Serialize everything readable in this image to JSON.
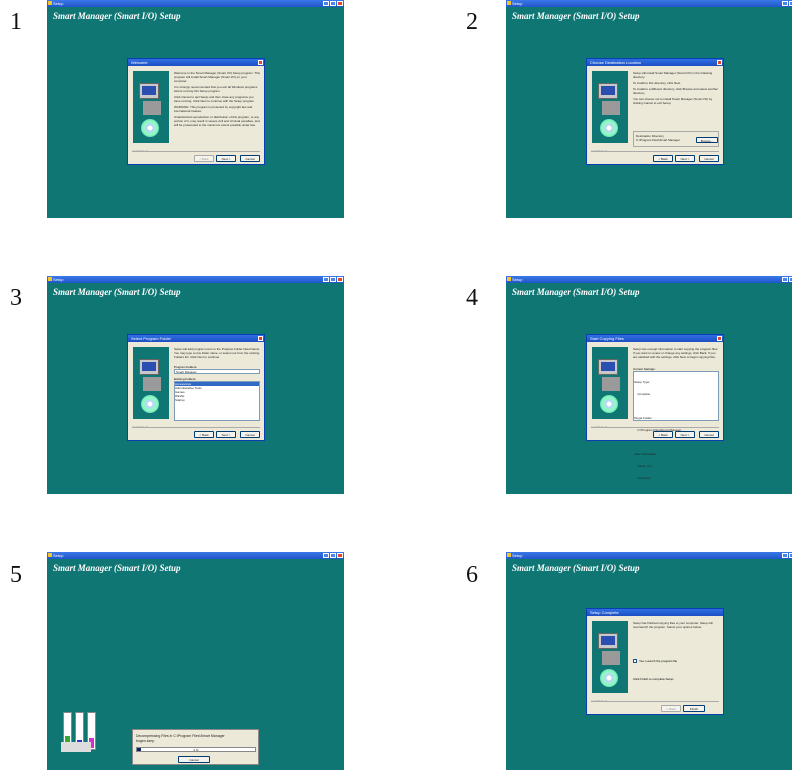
{
  "steps": [
    {
      "number": "1",
      "window_title": "Setup",
      "app_title": "Smart Manager (Smart I/O) Setup",
      "dialog": {
        "title": "Welcome",
        "paragraphs": [
          "Welcome to the Smart Manager (Smart I/O) Setup program. This program will install Smart Manager (Smart I/O) on your computer.",
          "It is strongly recommended that you exit all Windows programs before running this Setup program.",
          "Click Cancel to quit Setup and then close any programs you have running. Click Next to continue with the Setup program.",
          "WARNING: This program is protected by copyright law and international treaties.",
          "Unauthorized reproduction or distribution of this program, or any portion of it, may result in severe civil and criminal penalties, and will be prosecuted to the maximum extent possible under law."
        ],
        "brand": "InstallShield",
        "back": "< Back",
        "next": "Next >",
        "cancel": "Cancel"
      }
    },
    {
      "number": "2",
      "window_title": "Setup",
      "app_title": "Smart Manager (Smart I/O) Setup",
      "dialog": {
        "title": "Choose Destination Location",
        "paragraphs": [
          "Setup will install Smart Manager (Smart I/O) in the following directory.",
          "To install to this directory, click Next.",
          "To install to a different directory, click Browse and select another directory.",
          "You can choose not to install Smart Manager (Smart I/O) by clicking Cancel to exit Setup."
        ],
        "group_label": "Destination Directory",
        "path": "C:\\Program Files\\Smart Manager",
        "browse": "Browse...",
        "brand": "InstallShield",
        "back": "< Back",
        "next": "Next >",
        "cancel": "Cancel"
      }
    },
    {
      "number": "3",
      "window_title": "Setup",
      "app_title": "Smart Manager (Smart I/O) Setup",
      "dialog": {
        "title": "Select Program Folder",
        "paragraphs": [
          "Setup will add program icons to the Program Folder listed below. You may type a new folder name, or select one from the existing Folders list. Click Next to continue."
        ],
        "program_folder_label": "Program Folders:",
        "program_folder_value": "Smart Manager",
        "existing_label": "Existing Folders:",
        "existing": [
          "Accessories",
          "Administrative Tools",
          "Games",
          "WinZip",
          "Startup"
        ],
        "brand": "InstallShield",
        "back": "< Back",
        "next": "Next >",
        "cancel": "Cancel"
      }
    },
    {
      "number": "4",
      "window_title": "Setup",
      "app_title": "Smart Manager (Smart I/O) Setup",
      "dialog": {
        "title": "Start Copying Files",
        "paragraphs": [
          "Setup has enough information to start copying the program files. If you want to review or change any settings, click Back. If you are satisfied with the settings, click Next to begin copying files."
        ],
        "settings_label": "Current Settings:",
        "settings": [
          "Setup Type:",
          "    Complete",
          "",
          "Target Folder:",
          "    C:\\Program Files\\Smart Manager",
          "",
          "User Information",
          "    Name: xxx",
          "    Company:"
        ],
        "brand": "InstallShield",
        "back": "< Back",
        "next": "Next >",
        "cancel": "Cancel"
      }
    },
    {
      "number": "5",
      "window_title": "Setup",
      "app_title": "Smart Manager (Smart I/O) Setup",
      "progress": {
        "line1": "Decompressing Files in C:\\Program Files\\Smart Manager",
        "line2": "bogen.lomp",
        "percent_text": "3 %",
        "percent": 3,
        "cancel": "Cancel"
      }
    },
    {
      "number": "6",
      "window_title": "Setup",
      "app_title": "Smart Manager (Smart I/O) Setup",
      "dialog": {
        "title": "Setup Complete",
        "paragraphs": [
          "Setup has finished copying files to your computer. Setup will now launch the program. Select your options below."
        ],
        "checkbox_label": "Yes, Launch the program file",
        "finish_text": "Click Finish to complete Setup.",
        "brand": "InstallShield",
        "back": "< Back",
        "finish": "Finish"
      }
    }
  ],
  "colors": {
    "desktop": "#0f7674",
    "titlebar": "#2f6fe3",
    "dialog_bg": "#ece9d8"
  }
}
